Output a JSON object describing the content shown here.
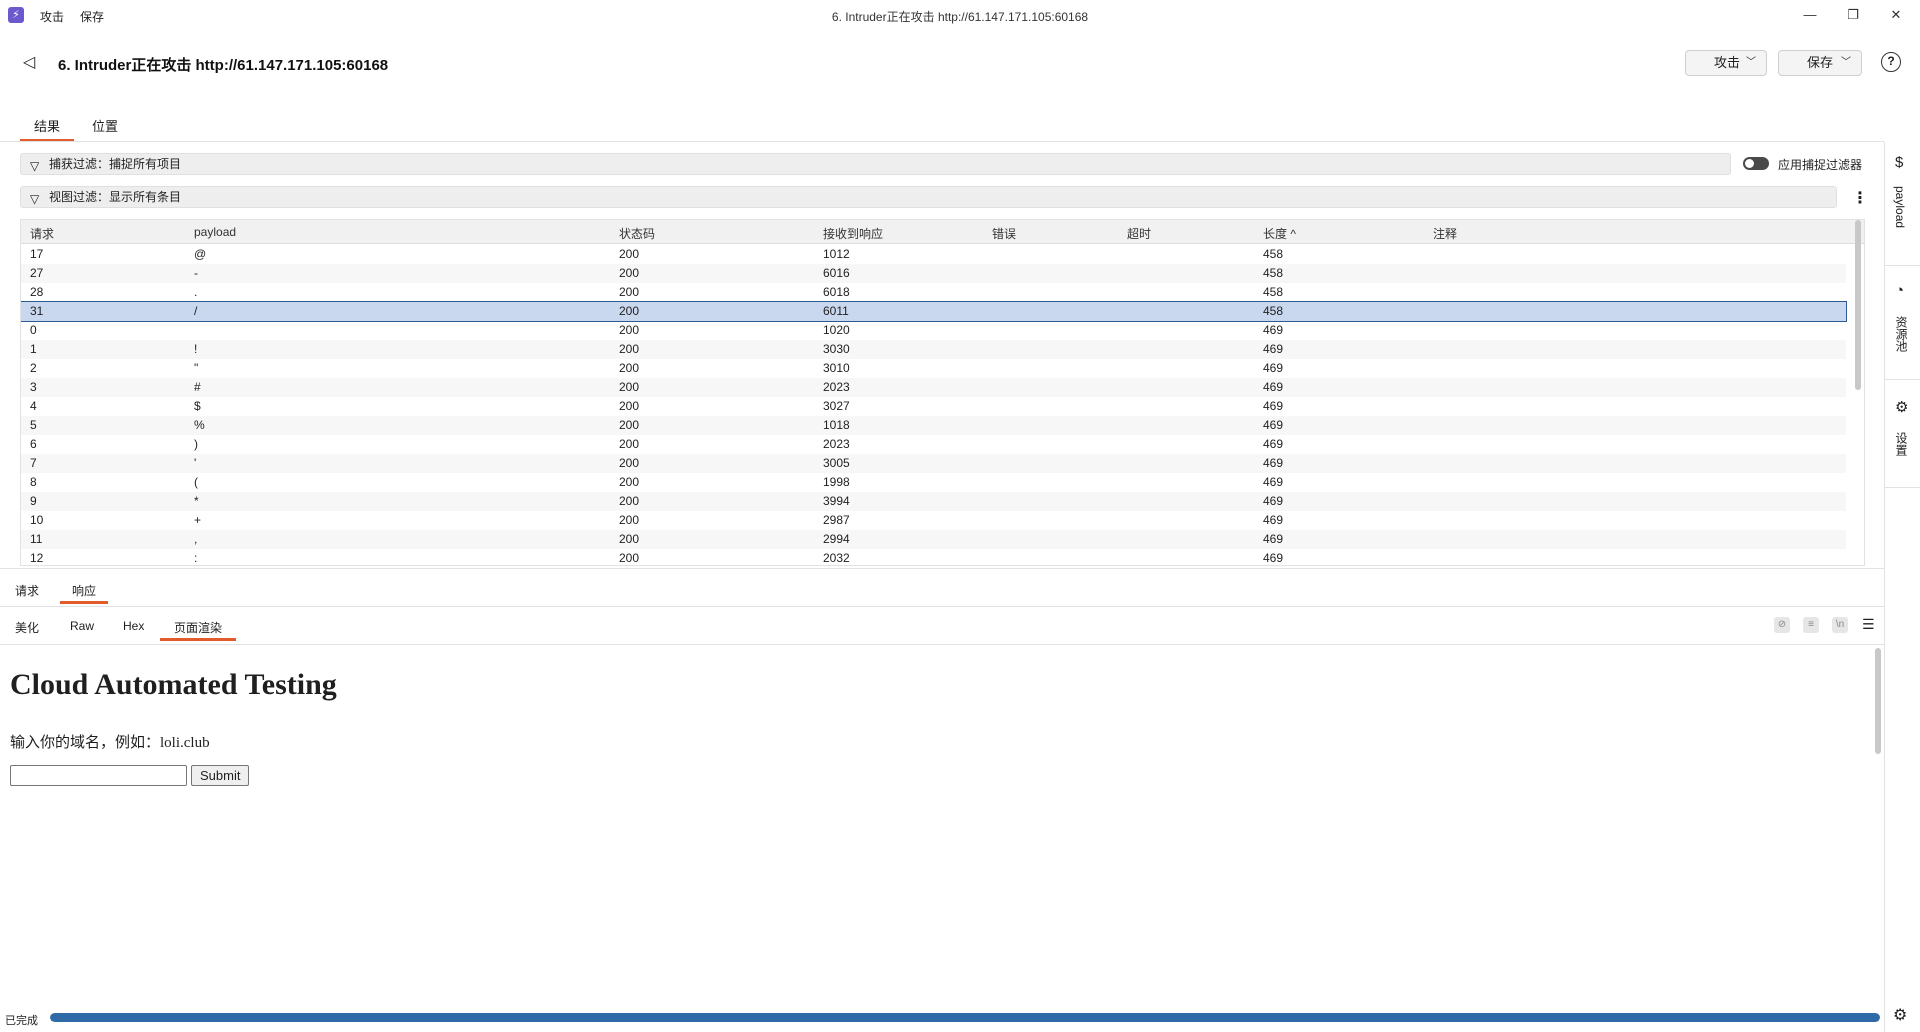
{
  "titlebar": {
    "menu": [
      "攻击",
      "保存"
    ],
    "title": "6. Intruder正在攻击 http://61.147.171.105:60168",
    "minimize": "—",
    "restore": "❐",
    "close": "✕"
  },
  "header": {
    "title": "6. Intruder正在攻击 http://61.147.171.105:60168",
    "attack_button": "攻击",
    "save_button": "保存",
    "help": "?"
  },
  "tabs": [
    "结果",
    "位置"
  ],
  "filters": {
    "capture": "捕获过滤：捕捉所有项目",
    "view": "视图过滤：显示所有条目",
    "toggle_label": "应用捕捉过滤器"
  },
  "table": {
    "columns": [
      "请求",
      "payload",
      "状态码",
      "接收到响应",
      "错误",
      "超时",
      "长度 ^",
      "注释"
    ],
    "selected_request": "31",
    "rows": [
      [
        "17",
        "@",
        "200",
        "1012",
        "",
        "",
        "458",
        ""
      ],
      [
        "27",
        "-",
        "200",
        "6016",
        "",
        "",
        "458",
        ""
      ],
      [
        "28",
        ".",
        "200",
        "6018",
        "",
        "",
        "458",
        ""
      ],
      [
        "31",
        "/",
        "200",
        "6011",
        "",
        "",
        "458",
        ""
      ],
      [
        "0",
        "",
        "200",
        "1020",
        "",
        "",
        "469",
        ""
      ],
      [
        "1",
        "!",
        "200",
        "3030",
        "",
        "",
        "469",
        ""
      ],
      [
        "2",
        "\"",
        "200",
        "3010",
        "",
        "",
        "469",
        ""
      ],
      [
        "3",
        "#",
        "200",
        "2023",
        "",
        "",
        "469",
        ""
      ],
      [
        "4",
        "$",
        "200",
        "3027",
        "",
        "",
        "469",
        ""
      ],
      [
        "5",
        "%",
        "200",
        "1018",
        "",
        "",
        "469",
        ""
      ],
      [
        "6",
        ")",
        "200",
        "2023",
        "",
        "",
        "469",
        ""
      ],
      [
        "7",
        "'",
        "200",
        "3005",
        "",
        "",
        "469",
        ""
      ],
      [
        "8",
        "(",
        "200",
        "1998",
        "",
        "",
        "469",
        ""
      ],
      [
        "9",
        "*",
        "200",
        "3994",
        "",
        "",
        "469",
        ""
      ],
      [
        "10",
        "+",
        "200",
        "2987",
        "",
        "",
        "469",
        ""
      ],
      [
        "11",
        ",",
        "200",
        "2994",
        "",
        "",
        "469",
        ""
      ],
      [
        "12",
        ":",
        "200",
        "2032",
        "",
        "",
        "469",
        ""
      ]
    ]
  },
  "sidebar": {
    "items": [
      {
        "icon": "$",
        "label": "payload"
      },
      {
        "icon": "◔",
        "label": "资源池"
      },
      {
        "icon": "⚙",
        "label": "设置"
      }
    ]
  },
  "lower": {
    "tabs": [
      "请求",
      "响应"
    ],
    "view_tabs": [
      "美化",
      "Raw",
      "Hex",
      "页面渲染"
    ]
  },
  "render": {
    "heading": "Cloud Automated Testing",
    "text": "输入你的域名，例如：loli.club",
    "submit": "Submit"
  },
  "status": {
    "text": "已完成",
    "progress": 1.0
  },
  "colors": {
    "accent": "#e25c2b",
    "selection": "#c9d8ee",
    "progress": "#2e6aa8"
  }
}
